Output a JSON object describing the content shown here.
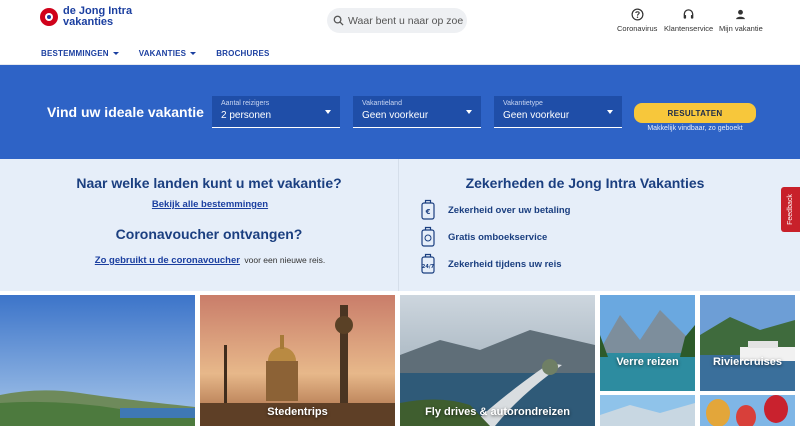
{
  "brand": {
    "line1": "de Jong Intra",
    "line2": "vakanties"
  },
  "search": {
    "placeholder": "Waar bent u naar op zoek?"
  },
  "utility": {
    "coronavirus": "Coronavirus",
    "service": "Klantenservice",
    "account": "Mijn vakantie"
  },
  "nav": {
    "destinations": "BESTEMMINGEN",
    "holidays": "VAKANTIES",
    "brochures": "BROCHURES"
  },
  "finder": {
    "title": "Vind uw ideale vakantie",
    "travellers_label": "Aantal reizigers",
    "travellers_value": "2 personen",
    "country_label": "Vakantieland",
    "country_value": "Geen voorkeur",
    "type_label": "Vakantietype",
    "type_value": "Geen voorkeur",
    "results_button": "RESULTATEN",
    "results_note": "Makkelijk vindbaar, zo geboekt"
  },
  "info": {
    "countries_title": "Naar welke landen kunt u met vakantie?",
    "countries_link": "Bekijk alle bestemmingen",
    "voucher_title": "Coronavoucher ontvangen?",
    "voucher_link": "Zo gebruikt u de coronavoucher",
    "voucher_suffix": "voor een nieuwe reis.",
    "certainties_title": "Zekerheden de Jong Intra Vakanties",
    "usp": [
      "Zekerheid over uw betaling",
      "Gratis omboekservice",
      "Zekerheid tijdens uw reis"
    ]
  },
  "feedback": "Feedback",
  "tiles": {
    "city": "Stedentrips",
    "fly": "Fly drives & autorondreizen",
    "far": "Verre reizen",
    "river": "Riviercruises"
  },
  "colors": {
    "brand_blue": "#1b3fa0",
    "banner": "#2e63c6",
    "button": "#f7c73b",
    "feedback": "#c8202a"
  }
}
